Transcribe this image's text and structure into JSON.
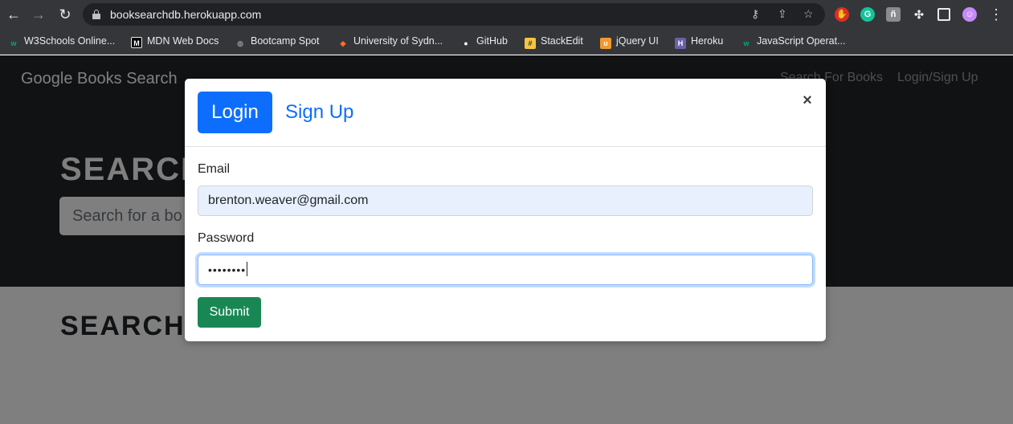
{
  "browser": {
    "url": "booksearchdb.herokuapp.com",
    "bookmarks": [
      {
        "label": "W3Schools Online...",
        "icon": "w3schools-icon",
        "color": "#04aa6d"
      },
      {
        "label": "MDN Web Docs",
        "icon": "mdn-icon",
        "color": "#000000"
      },
      {
        "label": "Bootcamp Spot",
        "icon": "globe-icon",
        "color": "#8a8b8f"
      },
      {
        "label": "University of Sydn...",
        "icon": "gitlab-icon",
        "color": "#fc6d26"
      },
      {
        "label": "GitHub",
        "icon": "github-icon",
        "color": "#ffffff"
      },
      {
        "label": "StackEdit",
        "icon": "stackedit-icon",
        "color": "#f5c542"
      },
      {
        "label": "jQuery UI",
        "icon": "jquery-ui-icon",
        "color": "#f29a2e"
      },
      {
        "label": "Heroku",
        "icon": "heroku-icon",
        "color": "#6762a6"
      },
      {
        "label": "JavaScript Operat...",
        "icon": "w3schools-icon",
        "color": "#04aa6d"
      }
    ]
  },
  "site": {
    "brand": "Google Books Search",
    "nav_search": "Search For Books",
    "nav_login": "Login/Sign Up",
    "hero_title": "SEARCH",
    "search_placeholder": "Search for a bo",
    "section_title": "SEARCH"
  },
  "modal": {
    "tab_login": "Login",
    "tab_signup": "Sign Up",
    "close_glyph": "×",
    "email_label": "Email",
    "email_value": "brenton.weaver@gmail.com",
    "password_label": "Password",
    "password_value": "••••••••",
    "submit_label": "Submit"
  },
  "colors": {
    "primary": "#0d6efd",
    "success": "#198754",
    "navbar": "#212529"
  }
}
